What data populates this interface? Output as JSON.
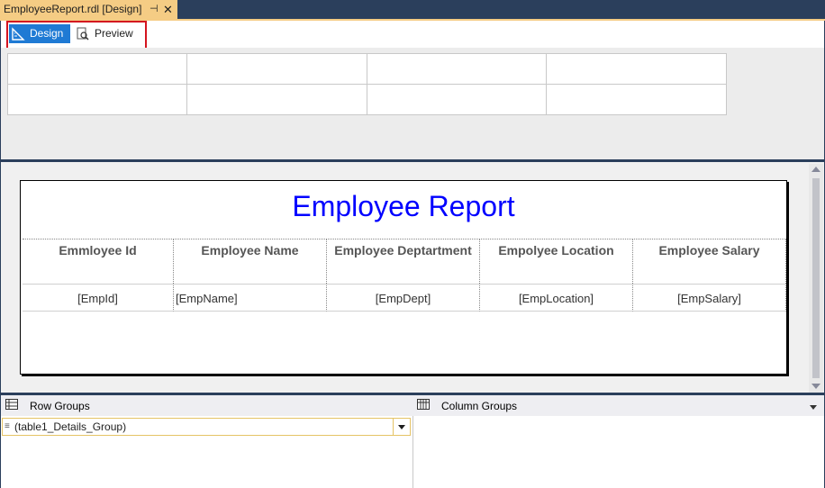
{
  "document_tab": {
    "title": "EmployeeReport.rdl [Design]",
    "pin_glyph": "⊣",
    "close_glyph": "✕"
  },
  "view_toggle": {
    "design_label": "Design",
    "preview_label": "Preview"
  },
  "report": {
    "title": "Employee Report",
    "columns": [
      "Emmloyee Id",
      "Employee Name",
      "Employee Deptartment",
      "Empolyee Location",
      "Employee Salary"
    ],
    "details": [
      "[EmpId]",
      "[EmpName]",
      "[EmpDept]",
      "[EmpLocation]",
      "[EmpSalary]"
    ],
    "title_color": "#0000ff"
  },
  "grouping": {
    "row_groups_label": "Row Groups",
    "column_groups_label": "Column Groups",
    "row_group_items": [
      "(table1_Details_Group)"
    ]
  },
  "colors": {
    "accent": "#1f7ad4",
    "highlight_box": "#d4141f",
    "tab": "#f5cc84",
    "frame": "#2b3f5c"
  }
}
